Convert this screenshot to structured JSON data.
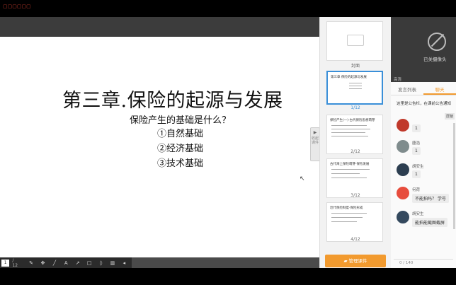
{
  "topbar": {
    "logo_text": "▢▢▢▢▢▢"
  },
  "slide": {
    "title": "第三章.保险的起源与发展",
    "question": "保险产生的基础是什么？",
    "items": [
      "①自然基础",
      "②经济基础",
      "③技术基础"
    ]
  },
  "toolbar": {
    "page_current": "1",
    "page_total": "/ 12",
    "tools": [
      "pen-icon",
      "move-icon",
      "brush-icon",
      "text-icon",
      "arrow-icon",
      "rectangle-icon",
      "eraser-icon",
      "delete-icon",
      "prev-icon"
    ]
  },
  "collapse_handle": {
    "label": "收起课件"
  },
  "thumbnails": {
    "items": [
      {
        "label": "封面",
        "title": ""
      },
      {
        "label": "1/12",
        "title": "第三章 保险的起源与发展"
      },
      {
        "label": "2/12",
        "title": "保险产生(一)·古代保险思想萌芽"
      },
      {
        "label": "3/12",
        "title": "古代海上保险萌芽·保险发展"
      },
      {
        "label": "4/12",
        "title": "近代保险制度·保险形成"
      }
    ],
    "manage_button": "管理课件"
  },
  "camera": {
    "label": "已关摄像头",
    "signal": "高清"
  },
  "chat": {
    "tabs": [
      "发言列表",
      "聊天"
    ],
    "active_tab": 1,
    "notice": "这里是公告栏，在课前公告通知",
    "notice_button": "屏蔽",
    "messages": [
      {
        "name": "",
        "text": "1"
      },
      {
        "name": "唐浩",
        "text": "1"
      },
      {
        "name": "胡安生",
        "text": "1"
      },
      {
        "name": "何荷",
        "text": "不能拍吗？ 学号"
      },
      {
        "name": "胡安生",
        "text": "能拍能截图截屏"
      }
    ],
    "input_counter": "0 / 140"
  },
  "colors": {
    "accent": "#f29a2e",
    "active_thumb": "#3a8fd8"
  }
}
